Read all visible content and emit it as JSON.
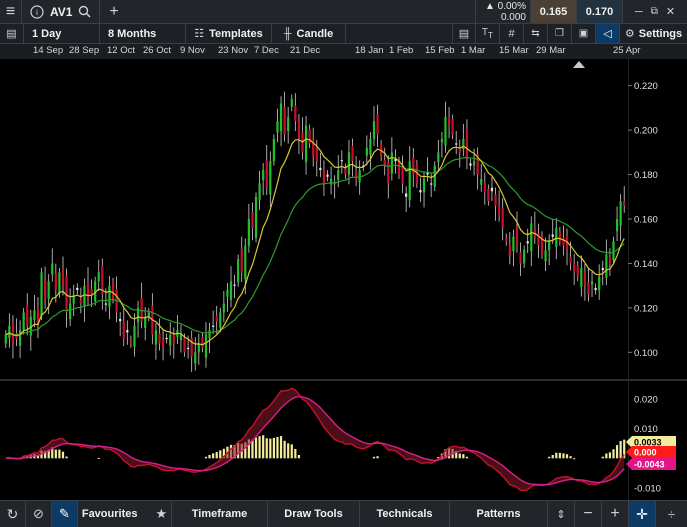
{
  "topbar": {
    "menu_icon": "≡",
    "symbol": "AV1",
    "change_pct": "▲ 0.00%",
    "change_abs": "0.000",
    "bid": "0.165",
    "ask": "0.170",
    "colors": {
      "bid_bg": "#4a4033",
      "ask_bg": "#223240"
    }
  },
  "toolbar": {
    "interval": "1 Day",
    "range": "8 Months",
    "templates": "Templates",
    "style": "Candle",
    "settings": "Settings"
  },
  "dates": [
    "14 Sep",
    "28 Sep",
    "12 Oct",
    "26 Oct",
    "9 Nov",
    "23 Nov",
    "7 Dec",
    "21 Dec",
    "18 Jan",
    "1 Feb",
    "15 Feb",
    "1 Mar",
    "15 Mar",
    "29 Mar",
    "25 Apr"
  ],
  "bottombar": {
    "favourites": "Favourites",
    "timeframe": "Timeframe",
    "draw_tools": "Draw Tools",
    "technicals": "Technicals",
    "patterns": "Patterns"
  },
  "chart_data": {
    "type": "candlestick",
    "price_axis": {
      "ticks": [
        "0.220",
        "0.200",
        "0.180",
        "0.160",
        "0.140",
        "0.120",
        "0.100"
      ],
      "ylim": [
        0.088,
        0.232
      ]
    },
    "indicator_axis": {
      "ticks": [
        "0.020",
        "0.010",
        "0.000",
        "-0.010"
      ],
      "ylim": [
        -0.013,
        0.026
      ]
    },
    "indicator_labels": {
      "macd": "0.0033",
      "zero": "0.000",
      "signal": "-0.0043"
    },
    "colors": {
      "up": "#22c02a",
      "down": "#c8102e",
      "doji": "#e8e8e8",
      "ma_short": "#d8c832",
      "ma_long": "#2e9a2e",
      "macd": "#c8102e",
      "signal": "#d6208e",
      "histogram": "#f3ec9a"
    },
    "closes": [
      0.108,
      0.112,
      0.104,
      0.106,
      0.11,
      0.118,
      0.112,
      0.116,
      0.119,
      0.112,
      0.136,
      0.124,
      0.132,
      0.14,
      0.128,
      0.136,
      0.13,
      0.118,
      0.122,
      0.126,
      0.128,
      0.122,
      0.13,
      0.124,
      0.126,
      0.132,
      0.136,
      0.126,
      0.122,
      0.13,
      0.124,
      0.118,
      0.114,
      0.106,
      0.11,
      0.104,
      0.112,
      0.12,
      0.114,
      0.116,
      0.118,
      0.108,
      0.11,
      0.104,
      0.102,
      0.106,
      0.108,
      0.104,
      0.11,
      0.108,
      0.1,
      0.102,
      0.098,
      0.1,
      0.104,
      0.102,
      0.108,
      0.11,
      0.112,
      0.114,
      0.118,
      0.122,
      0.128,
      0.132,
      0.13,
      0.142,
      0.136,
      0.148,
      0.16,
      0.156,
      0.17,
      0.176,
      0.182,
      0.174,
      0.186,
      0.196,
      0.204,
      0.212,
      0.198,
      0.206,
      0.214,
      0.204,
      0.196,
      0.19,
      0.202,
      0.194,
      0.188,
      0.186,
      0.182,
      0.176,
      0.18,
      0.178,
      0.176,
      0.182,
      0.186,
      0.18,
      0.19,
      0.186,
      0.178,
      0.182,
      0.184,
      0.192,
      0.196,
      0.204,
      0.198,
      0.188,
      0.184,
      0.176,
      0.19,
      0.186,
      0.18,
      0.176,
      0.17,
      0.186,
      0.18,
      0.176,
      0.172,
      0.178,
      0.18,
      0.176,
      0.184,
      0.19,
      0.196,
      0.206,
      0.202,
      0.198,
      0.194,
      0.19,
      0.196,
      0.188,
      0.184,
      0.186,
      0.18,
      0.178,
      0.172,
      0.168,
      0.174,
      0.166,
      0.162,
      0.156,
      0.15,
      0.144,
      0.152,
      0.148,
      0.14,
      0.146,
      0.15,
      0.158,
      0.152,
      0.148,
      0.144,
      0.146,
      0.15,
      0.152,
      0.156,
      0.15,
      0.148,
      0.146,
      0.14,
      0.136,
      0.134,
      0.138,
      0.13,
      0.126,
      0.132,
      0.128,
      0.134,
      0.138,
      0.144,
      0.14,
      0.15,
      0.16,
      0.168,
      0.166
    ]
  }
}
